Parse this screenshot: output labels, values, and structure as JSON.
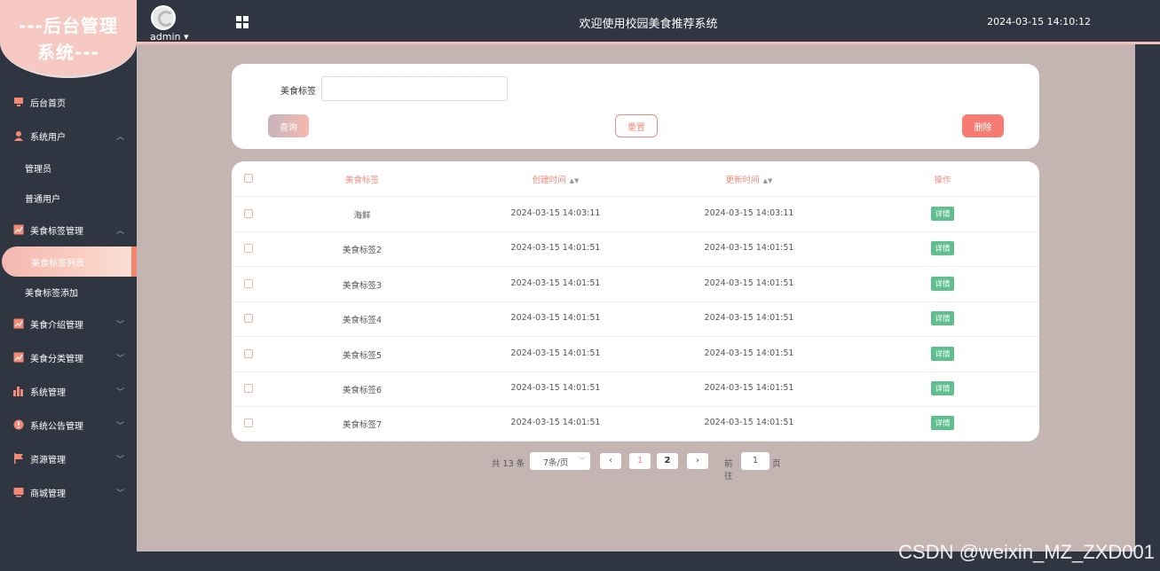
{
  "logo": {
    "line1": "---后台管理",
    "line2": "系统---"
  },
  "header": {
    "user": "admin ▾",
    "title": "欢迎使用校园美食推荐系统",
    "datetime": "2024-03-15 14:10:12"
  },
  "sidebar": {
    "home": "后台首页",
    "sys_user": "系统用户",
    "sub_admin": "管理员",
    "sub_normal": "普通用户",
    "tag_mgmt": "美食标签管理",
    "sub_tag_list": "美食标签列表",
    "sub_tag_add": "美食标签添加",
    "intro_mgmt": "美食介绍管理",
    "cat_mgmt": "美食分类管理",
    "sys_mgmt": "系统管理",
    "notice_mgmt": "系统公告管理",
    "res_mgmt": "资源管理",
    "shop_mgmt": "商城管理"
  },
  "search": {
    "label": "美食标签",
    "value": "",
    "query": "查询",
    "reset": "重置",
    "delete": "删除"
  },
  "table": {
    "headers": [
      "美食标签",
      "创建时间",
      "更新时间",
      "操作"
    ],
    "rows": [
      {
        "tag": "海鲜",
        "created": "2024-03-15 14:03:11",
        "updated": "2024-03-15 14:03:11",
        "action": "详情"
      },
      {
        "tag": "美食标签2",
        "created": "2024-03-15 14:01:51",
        "updated": "2024-03-15 14:01:51",
        "action": "详情"
      },
      {
        "tag": "美食标签3",
        "created": "2024-03-15 14:01:51",
        "updated": "2024-03-15 14:01:51",
        "action": "详情"
      },
      {
        "tag": "美食标签4",
        "created": "2024-03-15 14:01:51",
        "updated": "2024-03-15 14:01:51",
        "action": "详情"
      },
      {
        "tag": "美食标签5",
        "created": "2024-03-15 14:01:51",
        "updated": "2024-03-15 14:01:51",
        "action": "详情"
      },
      {
        "tag": "美食标签6",
        "created": "2024-03-15 14:01:51",
        "updated": "2024-03-15 14:01:51",
        "action": "详情"
      },
      {
        "tag": "美食标签7",
        "created": "2024-03-15 14:01:51",
        "updated": "2024-03-15 14:01:51",
        "action": "详情"
      }
    ]
  },
  "pager": {
    "total": "共 13 条",
    "size": "7条/页",
    "prev": "‹",
    "p1": "1",
    "p2": "2",
    "next": "›",
    "goto": "前往",
    "goto_val": "1",
    "page_unit": "页"
  },
  "watermark": "CSDN @weixin_MZ_ZXD001"
}
